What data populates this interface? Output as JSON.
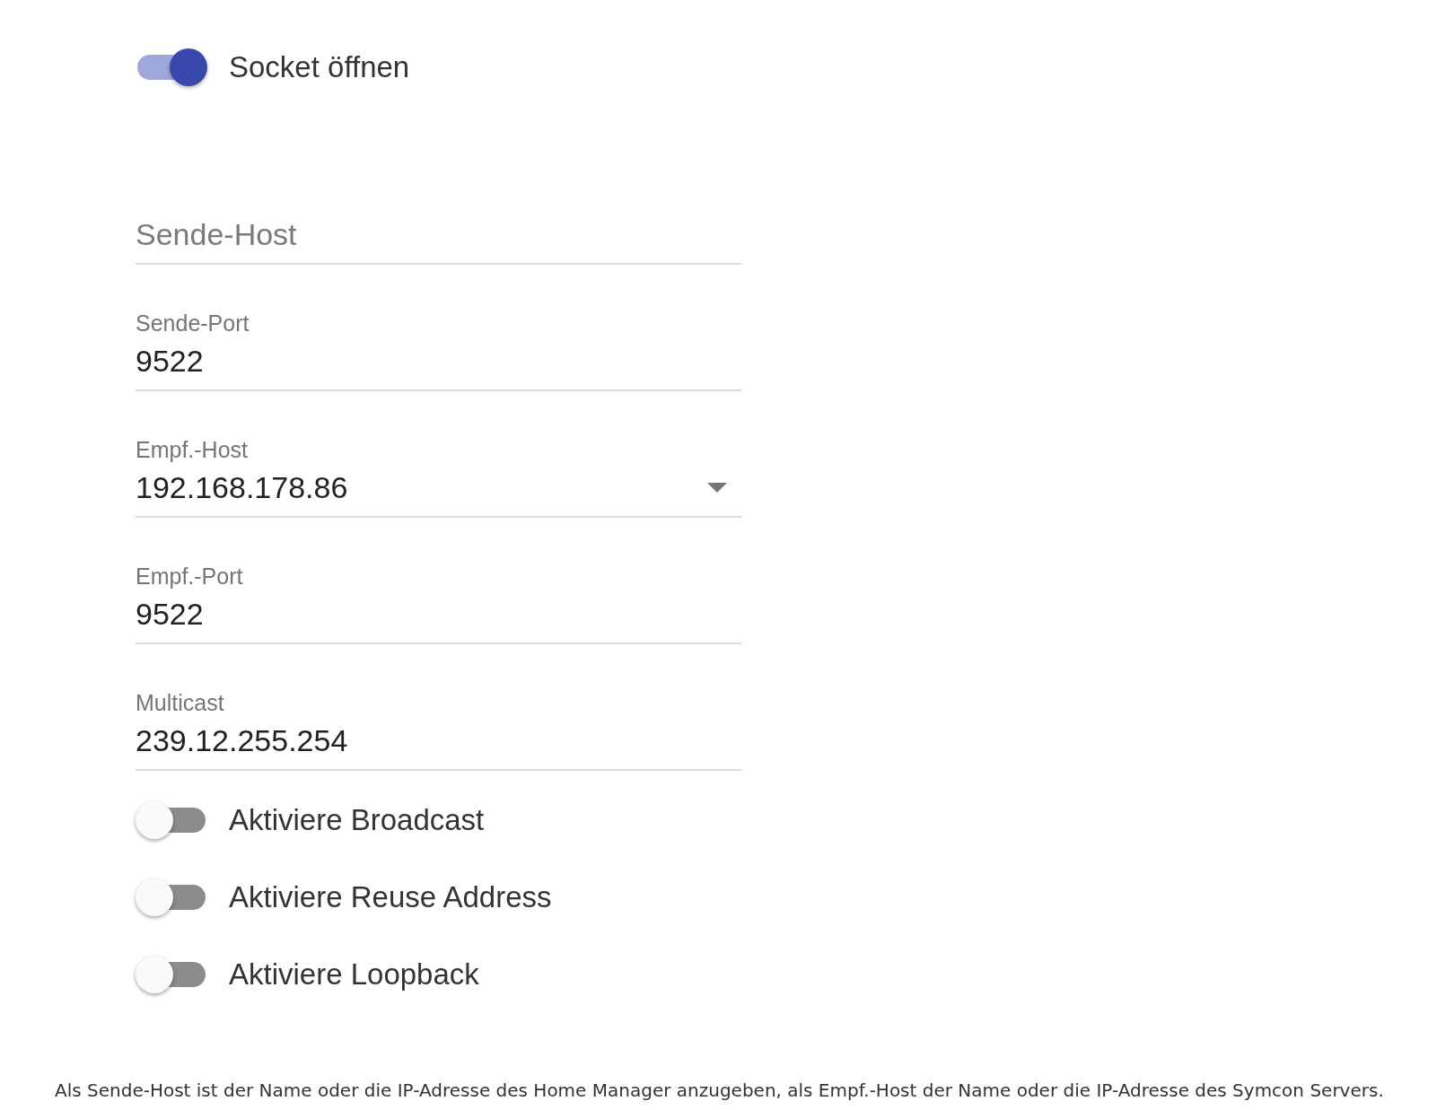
{
  "socket_toggle": {
    "label": "Socket öffnen",
    "on": true
  },
  "fields": [
    {
      "kind": "text",
      "placeholder": "Sende-Host"
    },
    {
      "kind": "text",
      "label": "Sende-Port",
      "value": "9522"
    },
    {
      "kind": "select",
      "label": "Empf.-Host",
      "value": "192.168.178.86"
    },
    {
      "kind": "text",
      "label": "Empf.-Port",
      "value": "9522"
    },
    {
      "kind": "text",
      "label": "Multicast",
      "value": "239.12.255.254"
    }
  ],
  "toggles": [
    {
      "label": "Aktiviere Broadcast",
      "on": false
    },
    {
      "label": "Aktiviere Reuse Address",
      "on": false
    },
    {
      "label": "Aktiviere Loopback",
      "on": false
    }
  ],
  "note": "Als Sende-Host ist der Name oder die IP-Adresse des Home Manager anzugeben, als Empf.-Host der Name oder die IP-Adresse des Symcon Servers."
}
